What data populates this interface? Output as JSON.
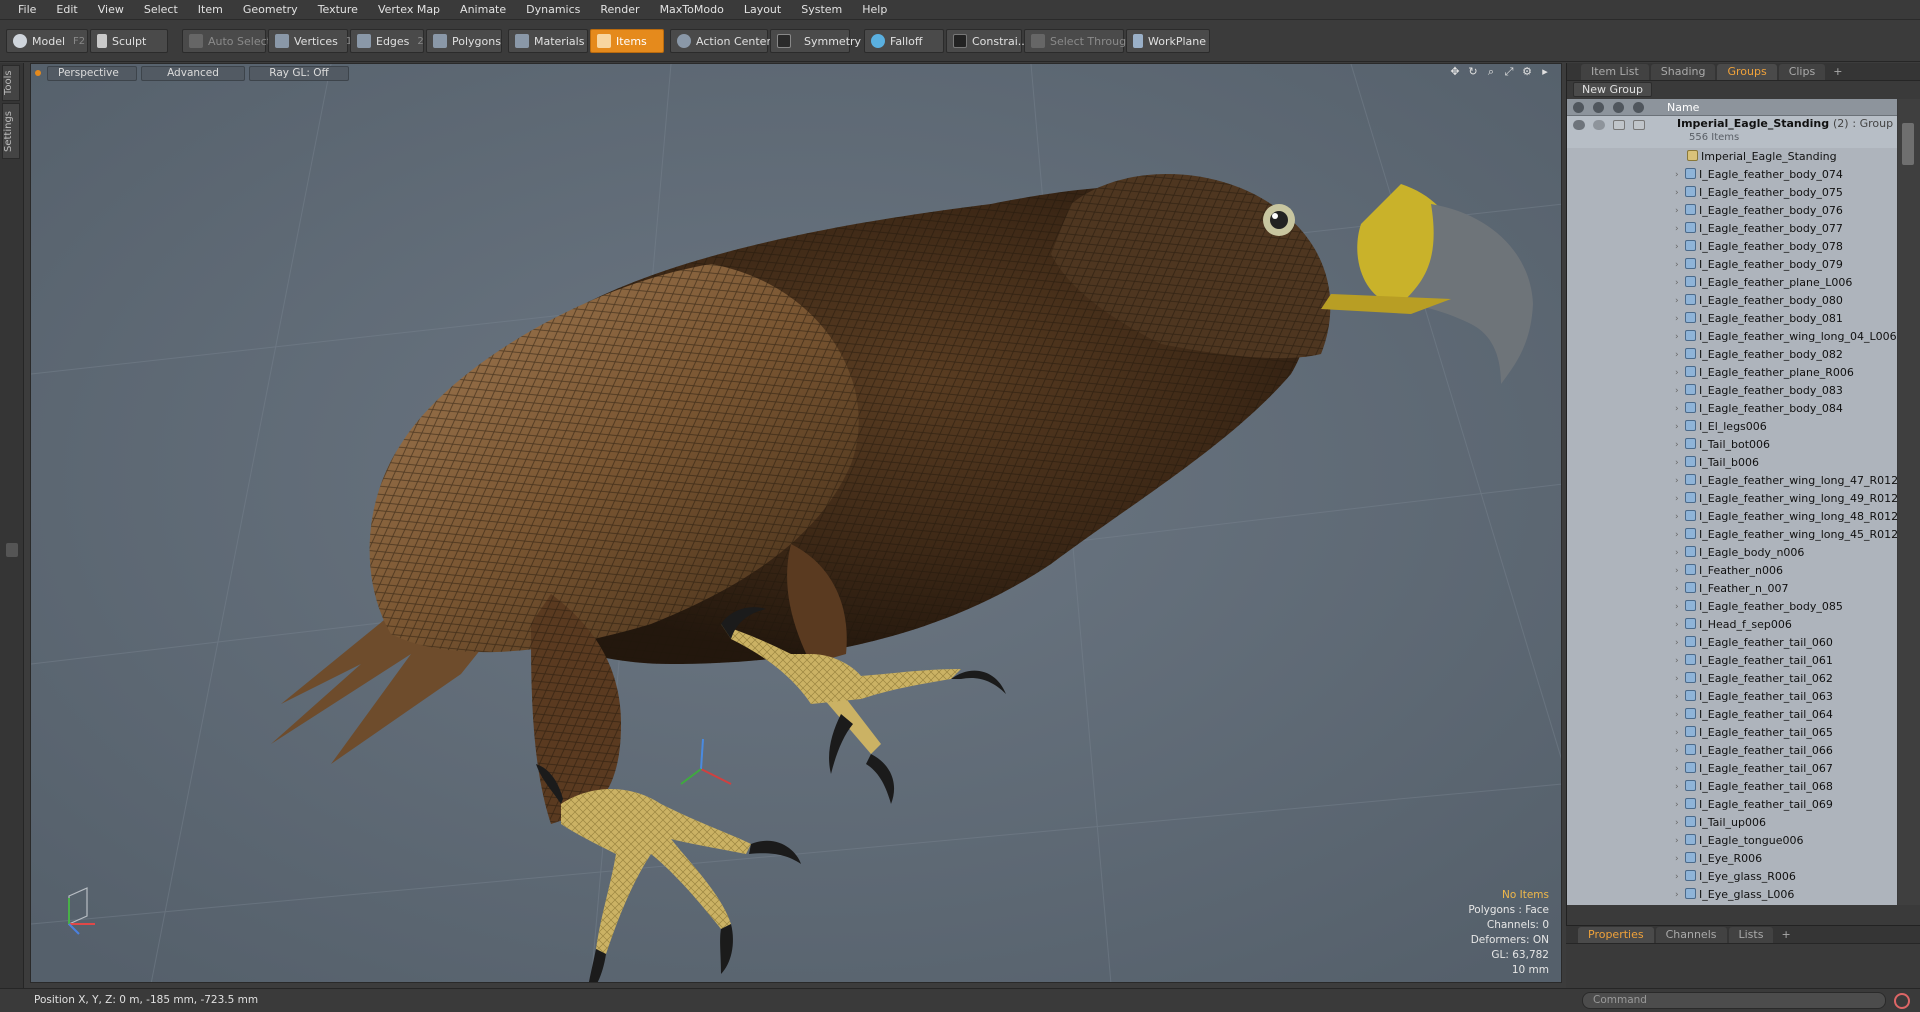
{
  "menu": [
    "File",
    "Edit",
    "View",
    "Select",
    "Item",
    "Geometry",
    "Texture",
    "Vertex Map",
    "Animate",
    "Dynamics",
    "Render",
    "MaxToModo",
    "Layout",
    "System",
    "Help"
  ],
  "toolbar": {
    "model": {
      "label": "Model",
      "key": "F2"
    },
    "sculpt": {
      "label": "Sculpt"
    },
    "auto_select": {
      "label": "Auto Select"
    },
    "vertices": {
      "label": "Vertices",
      "key": "1"
    },
    "edges": {
      "label": "Edges",
      "key": "2"
    },
    "polygons": {
      "label": "Polygons"
    },
    "materials": {
      "label": "Materials"
    },
    "items": {
      "label": "Items",
      "state": "active"
    },
    "action_center": {
      "label": "Action Center"
    },
    "symmetry": {
      "label": "Symmetry"
    },
    "falloff": {
      "label": "Falloff"
    },
    "constraints": {
      "label": "Constrai..."
    },
    "select_through": {
      "label": "Select Through"
    },
    "workplane": {
      "label": "WorkPlane"
    }
  },
  "left_tabs": {
    "tools": "Tools",
    "settings": "Settings"
  },
  "viewport": {
    "perspective": "Perspective",
    "advanced": "Advanced",
    "raygl": "Ray GL: Off",
    "hud": {
      "items": "No Items",
      "polygons": "Polygons : Face",
      "channels": "Channels: 0",
      "deformers": "Deformers: ON",
      "gl": "GL: 63,782",
      "scale": "10 mm"
    }
  },
  "right_panel": {
    "tabs": [
      "Item List",
      "Shading",
      "Groups",
      "Clips",
      "+"
    ],
    "active_tab": "Groups",
    "new_group": "New Group",
    "col_name": "Name",
    "root": {
      "name": "Imperial_Eagle_Standing",
      "count": "(2)",
      "kind": ": Group",
      "sub": "556 Items"
    },
    "items": [
      "Imperial_Eagle_Standing",
      "I_Eagle_feather_body_074",
      "I_Eagle_feather_body_075",
      "I_Eagle_feather_body_076",
      "I_Eagle_feather_body_077",
      "I_Eagle_feather_body_078",
      "I_Eagle_feather_body_079",
      "I_Eagle_feather_plane_L006",
      "I_Eagle_feather_body_080",
      "I_Eagle_feather_body_081",
      "I_Eagle_feather_wing_long_04_L006",
      "I_Eagle_feather_body_082",
      "I_Eagle_feather_plane_R006",
      "I_Eagle_feather_body_083",
      "I_Eagle_feather_body_084",
      "I_El_legs006",
      "I_Tail_bot006",
      "I_Tail_b006",
      "I_Eagle_feather_wing_long_47_R012",
      "I_Eagle_feather_wing_long_49_R012",
      "I_Eagle_feather_wing_long_48_R012",
      "I_Eagle_feather_wing_long_45_R012",
      "I_Eagle_body_n006",
      "I_Feather_n006",
      "I_Feather_n_007",
      "I_Eagle_feather_body_085",
      "I_Head_f_sep006",
      "I_Eagle_feather_tail_060",
      "I_Eagle_feather_tail_061",
      "I_Eagle_feather_tail_062",
      "I_Eagle_feather_tail_063",
      "I_Eagle_feather_tail_064",
      "I_Eagle_feather_tail_065",
      "I_Eagle_feather_tail_066",
      "I_Eagle_feather_tail_067",
      "I_Eagle_feather_tail_068",
      "I_Eagle_feather_tail_069",
      "I_Tail_up006",
      "I_Eagle_tongue006",
      "I_Eye_R006",
      "I_Eye_glass_R006",
      "I_Eye_glass_L006"
    ]
  },
  "properties": {
    "tabs": [
      "Properties",
      "Channels",
      "Lists",
      "+"
    ],
    "active_tab": "Properties"
  },
  "status": {
    "position": "Position X, Y, Z:  0 m, -185 mm, -723.5 mm",
    "command_placeholder": "Command"
  },
  "colors": {
    "accent": "#e58a1c",
    "viewport_bg": "#5f6a75",
    "tree_bg": "#aeb4bc"
  },
  "icons": [
    "model-icon",
    "sculpt-icon",
    "vertices-icon",
    "edges-icon",
    "polygons-icon",
    "materials-icon",
    "items-icon",
    "action-center-icon",
    "symmetry-icon",
    "falloff-icon",
    "constraints-icon",
    "select-through-icon",
    "workplane-icon",
    "move-icon",
    "rotate-icon",
    "zoom-icon",
    "maximize-icon",
    "gear-icon",
    "eye-icon",
    "mesh-icon"
  ]
}
